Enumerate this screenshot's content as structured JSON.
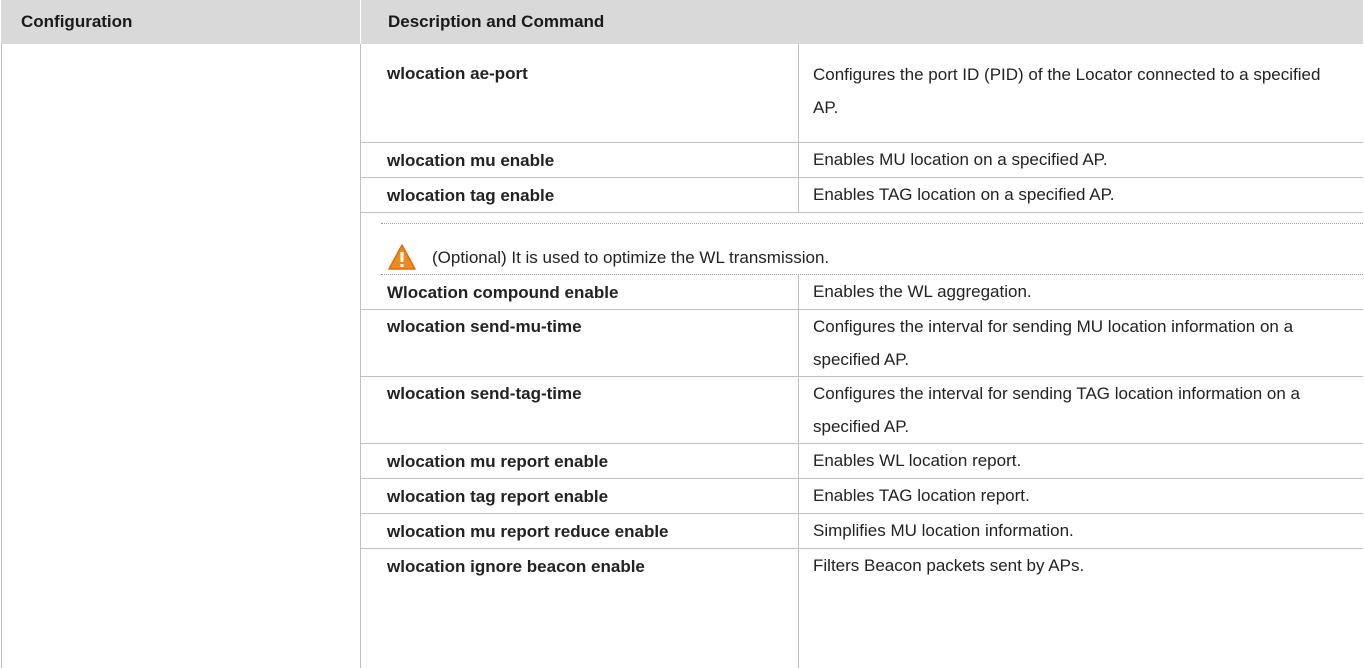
{
  "header": {
    "configuration": "Configuration",
    "description_and_command": "Description and Command"
  },
  "rows_group1": [
    {
      "command": "wlocation ae-port",
      "description": "Configures the port ID (PID) of the Locator connected to a specified AP."
    },
    {
      "command": "wlocation mu enable",
      "description": "Enables MU location on a specified AP."
    },
    {
      "command": "wlocation tag enable",
      "description": "Enables TAG location on a specified AP."
    }
  ],
  "note": {
    "icon": "warning-icon",
    "text": "(Optional) It is used to optimize the WL transmission."
  },
  "rows_group2": [
    {
      "command": "Wlocation compound enable",
      "description": "Enables the WL aggregation."
    },
    {
      "command": "wlocation send-mu-time",
      "description": "Configures the interval for sending MU location information on a specified AP."
    },
    {
      "command": "wlocation send-tag-time",
      "description": "Configures the interval for sending TAG location information on a specified AP."
    },
    {
      "command": "wlocation mu report enable",
      "description": "Enables WL location report."
    },
    {
      "command": "wlocation tag report enable",
      "description": "Enables TAG location report."
    },
    {
      "command": "wlocation mu report reduce enable",
      "description": "Simplifies MU location information."
    },
    {
      "command": "wlocation ignore beacon enable",
      "description": "Filters Beacon packets sent by APs."
    }
  ],
  "colors": {
    "header_background": "#d9d9d9",
    "grid_line": "#bfbfbf",
    "warning_orange": "#f08a1c"
  }
}
